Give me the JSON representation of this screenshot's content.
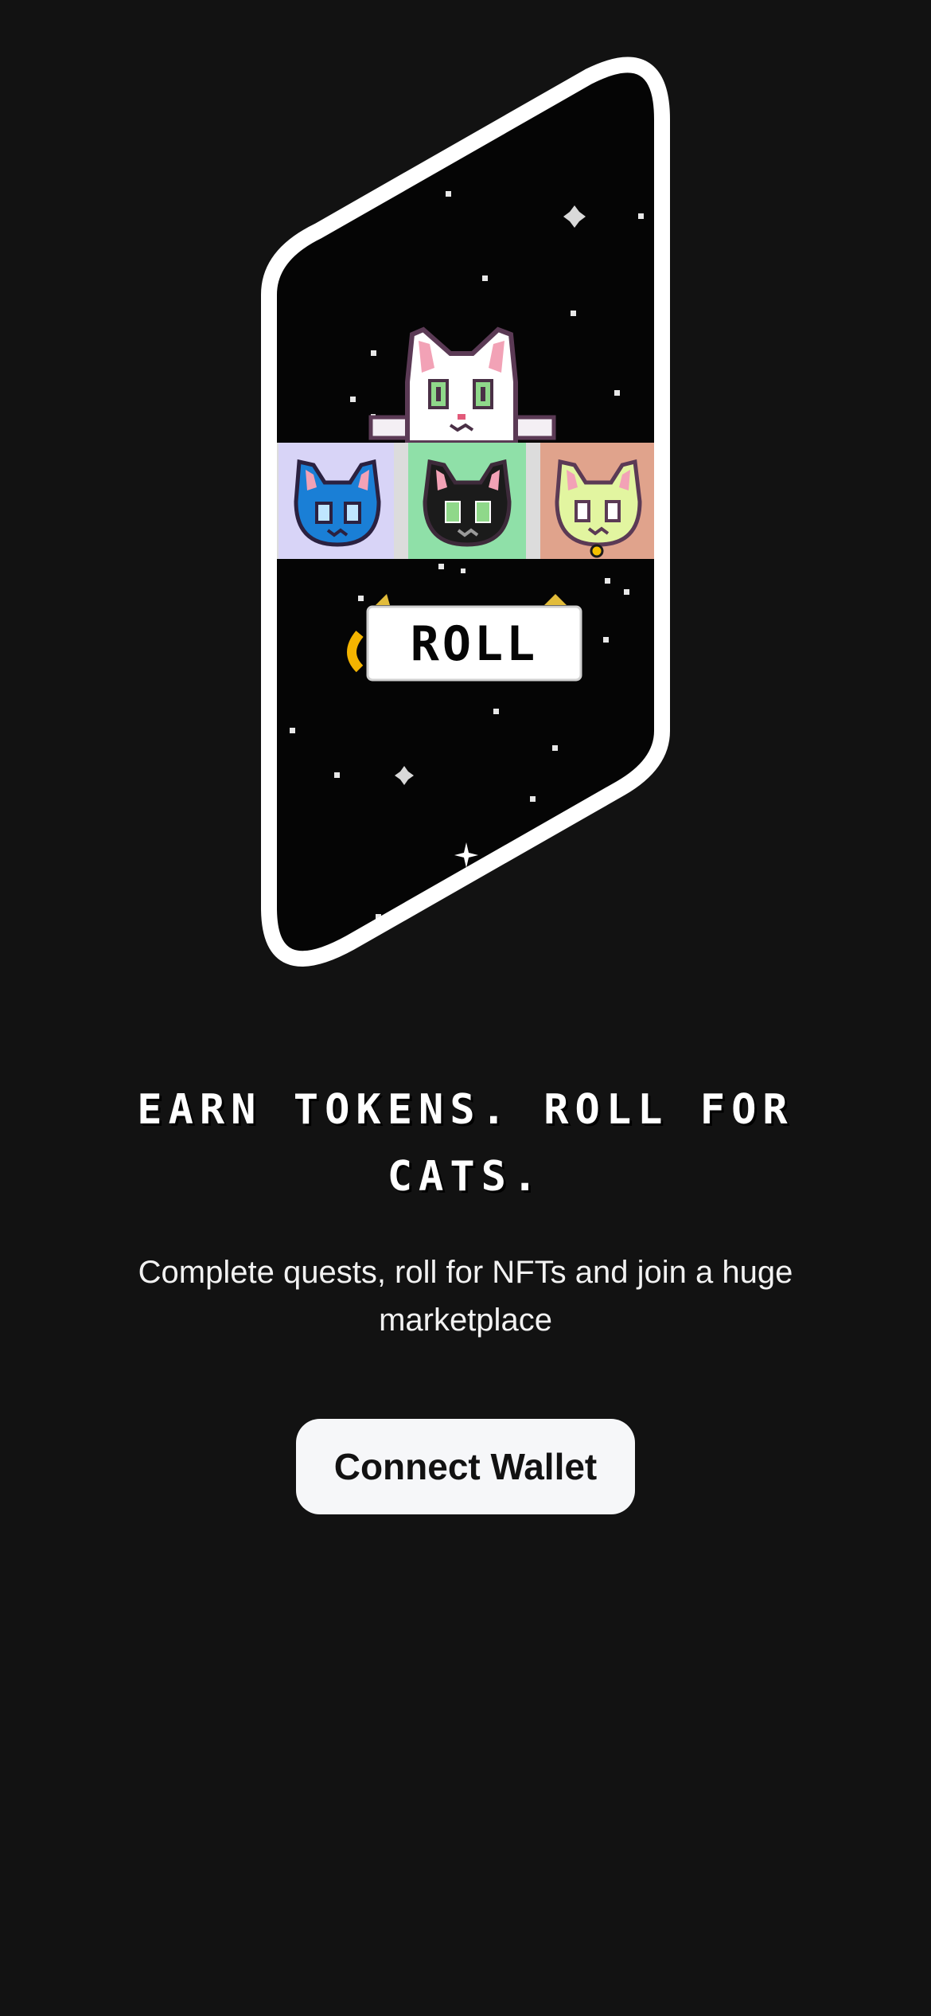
{
  "hero": {
    "roll_label": "ROLL",
    "icons": [
      "white-cat-icon",
      "blue-cat-icon",
      "black-cat-icon",
      "lime-cat-icon",
      "coin-icon"
    ]
  },
  "onboarding": {
    "headline": "Earn tokens. Roll for cats.",
    "subtitle": "Complete quests, roll for NFTs and join a huge marketplace"
  },
  "actions": {
    "connect_label": "Connect Wallet"
  },
  "colors": {
    "background": "#121212",
    "frame": "#ffffff",
    "slot_blue_bg": "#d8d4f7",
    "slot_green_bg": "#8fe0a8",
    "slot_peach_bg": "#e0a38c",
    "blue_cat": "#1a7fd6",
    "lime_cat": "#e2f5a0",
    "button_bg": "#f6f7f9"
  }
}
